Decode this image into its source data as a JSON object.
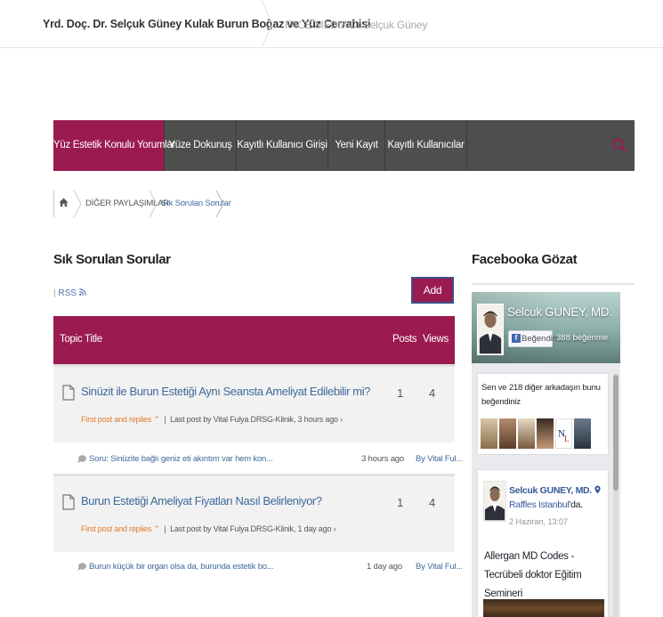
{
  "header": {
    "site_title": "Yrd. Doç. Dr. Selçuk Güney Kulak Burun Boğaz ve Yüz Cerrahisi",
    "secondary_link": "FACE MEDIA Dr.Selçuk Güney"
  },
  "nav": {
    "items": [
      {
        "label": "Yüz Estetik Konulu Yorumlar",
        "active": true
      },
      {
        "label": "Yüze Dokunuş",
        "active": false
      },
      {
        "label": "Kayıtlı Kullanıcı Girişi",
        "active": false
      },
      {
        "label": "Yeni Kayıt",
        "active": false
      },
      {
        "label": "Kayıtlı Kullanıcılar",
        "active": false
      }
    ],
    "search_icon": "search-icon"
  },
  "breadcrumb": {
    "home_icon": "home-icon",
    "items": [
      "DİĞER PAYLAŞIMLAR",
      "Sık Sorulan Sorular"
    ]
  },
  "forum": {
    "title": "Sık Sorulan Sorular",
    "rss_label": "RSS",
    "add_topic_label": "Add topic",
    "columns": {
      "topic": "Topic Title",
      "posts": "Posts",
      "views": "Views"
    },
    "topics": [
      {
        "title": "Sinüzit ile Burun Estetiği Aynı Seansta Ameliyat Edilebilir mi?",
        "first_post_label": "First post and replies",
        "last_post_prefix": "Last post by Vital Fulya DRSG-Klinik, 3 hours ago",
        "posts": "1",
        "views": "4",
        "reply_text": "Soru: Sinüzite bağlı geniz eti akıntım var hem kon...",
        "reply_time": "3 hours ago",
        "reply_by": "By Vital Ful..."
      },
      {
        "title": "Burun Estetiği Ameliyat Fiyatları Nasıl Belirleniyor?",
        "first_post_label": "First post and replies",
        "last_post_prefix": "Last post by Vital Fulya DRSG-Klinik, 1 day ago",
        "posts": "1",
        "views": "4",
        "reply_text": "Burun küçük bir organ olsa da, burunda estetik bo...",
        "reply_time": "1 day ago",
        "reply_by": "By Vital Ful..."
      }
    ]
  },
  "facebook": {
    "section_title": "Facebooka Gözat",
    "page_name": "Selcuk GUNEY, MD.",
    "like_button": "Beğendin",
    "like_count": "388 beğenme",
    "friends_text": "Sen ve 218 diğer arkadaşın bunu beğendiniz",
    "post": {
      "author": "Selcuk GUNEY, MD.",
      "location_link": "Raffles Istanbul",
      "location_suffix": "'da.",
      "date": "2 Haziran, 13:07",
      "text": "Allergan MD Codes - Tecrübeli doktor Eğitim Semineri"
    }
  },
  "colors": {
    "accent": "#9b1b51",
    "nav_bg": "#4e4e4e",
    "link": "#3f6a9a",
    "orange": "#e07a2a",
    "fb_blue": "#365899"
  }
}
